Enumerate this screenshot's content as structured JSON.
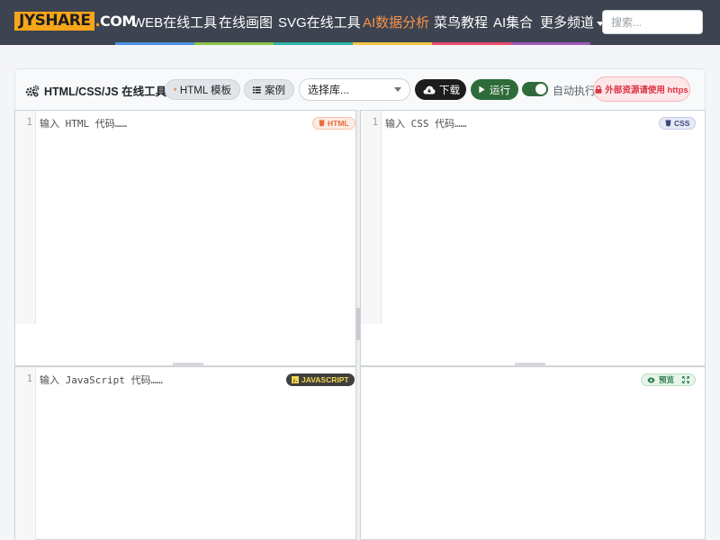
{
  "nav": {
    "logo_main": "JYSHARE",
    "logo_dot": ".",
    "logo_tail": "COM",
    "links": [
      {
        "label": "WEB在线工具"
      },
      {
        "label": "在线画图"
      },
      {
        "label": "SVG在线工具"
      },
      {
        "label": "AI数据分析"
      },
      {
        "label": "菜鸟教程"
      },
      {
        "label": "AI集合"
      },
      {
        "label": "更多频道"
      }
    ],
    "search_placeholder": "搜索...",
    "rainbow": [
      "#4a90e2",
      "#8bc34a",
      "#2bb5a8",
      "#f5c542",
      "#e94b6a",
      "#9b59b6"
    ]
  },
  "toolbar": {
    "title": "HTML/CSS/JS 在线工具",
    "template_button": "HTML 模板",
    "examples_button": "案例",
    "library_select": "选择库...",
    "download_button": "下载",
    "run_button": "运行",
    "auto_run_label": "自动执行",
    "auto_run_on": true,
    "https_badge": "外部资源请使用 https"
  },
  "editors": {
    "html": {
      "line": "1",
      "placeholder": "输入 HTML 代码……",
      "badge": "HTML"
    },
    "css": {
      "line": "1",
      "placeholder": "输入 CSS 代码……",
      "badge": "CSS"
    },
    "js": {
      "line": "1",
      "placeholder": "输入 JavaScript 代码……",
      "badge": "JAVASCRIPT"
    },
    "preview": {
      "badge": "预览"
    }
  },
  "colors": {
    "navbar": "#3d4350",
    "brand_orange": "#f7a61b",
    "active_link": "#f7934a",
    "run_green": "#2e6b3a",
    "https_red": "#dc3545"
  }
}
